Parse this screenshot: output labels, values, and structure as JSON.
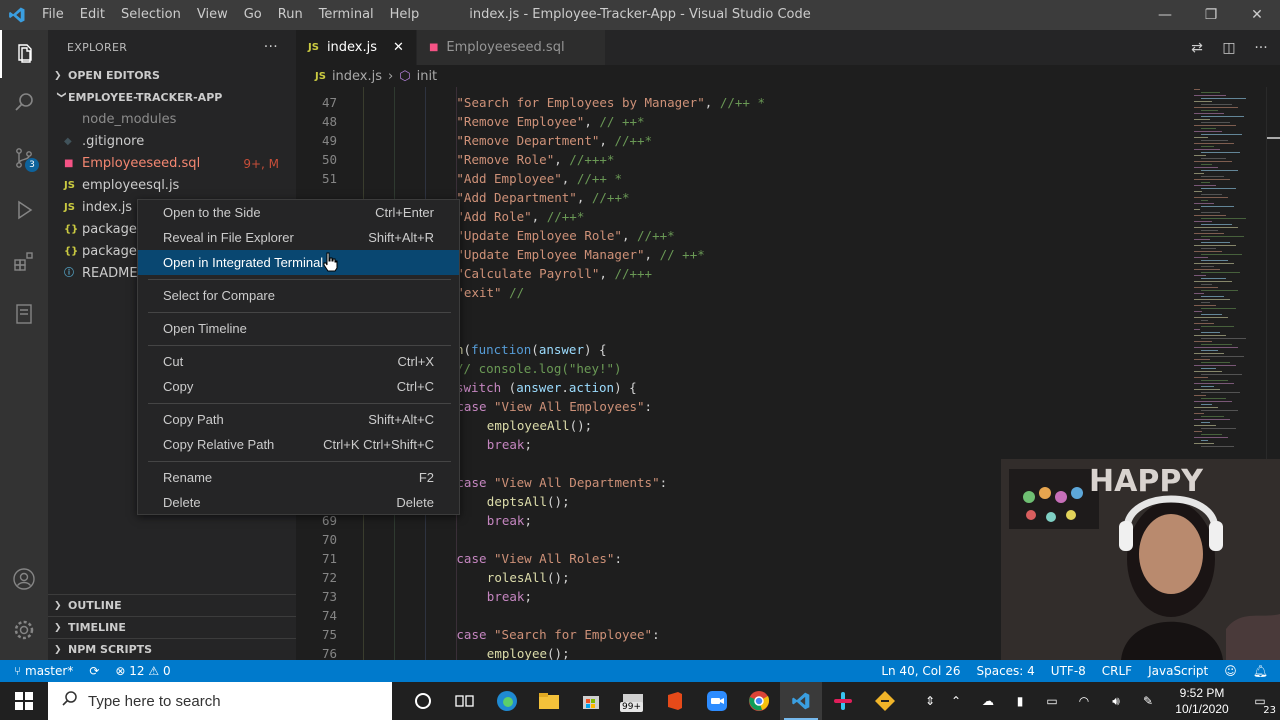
{
  "titlebar": {
    "menus": [
      "File",
      "Edit",
      "Selection",
      "View",
      "Go",
      "Run",
      "Terminal",
      "Help"
    ],
    "title": "index.js - Employee-Tracker-App - Visual Studio Code"
  },
  "activitybar": {
    "badge": "3"
  },
  "sidebar": {
    "title": "EXPLORER",
    "more": "···",
    "open_editors": "OPEN EDITORS",
    "project": "EMPLOYEE-TRACKER-APP",
    "files": [
      {
        "name": "node_modules",
        "icon": "",
        "color": "#8c8c8c",
        "status": ""
      },
      {
        "name": ".gitignore",
        "icon": "◆",
        "iconColor": "#41535b",
        "color": "#cccccc",
        "status": ""
      },
      {
        "name": "Employeeseed.sql",
        "icon": "■",
        "iconColor": "#f55385",
        "color": "#f48771",
        "status": "9+, M"
      },
      {
        "name": "employeesql.js",
        "icon": "JS",
        "iconColor": "#cbcb41",
        "color": "#cccccc",
        "status": ""
      },
      {
        "name": "index.js",
        "icon": "JS",
        "iconColor": "#cbcb41",
        "color": "#cccccc",
        "status": ""
      },
      {
        "name": "package-l",
        "icon": "{}",
        "iconColor": "#cbcb41",
        "color": "#cccccc",
        "status": ""
      },
      {
        "name": "package.js",
        "icon": "{}",
        "iconColor": "#cbcb41",
        "color": "#cccccc",
        "status": ""
      },
      {
        "name": "README.m",
        "icon": "ⓘ",
        "iconColor": "#519aba",
        "color": "#cccccc",
        "status": ""
      }
    ],
    "outline": "OUTLINE",
    "timeline": "TIMELINE",
    "npm": "NPM SCRIPTS"
  },
  "tabs": [
    {
      "label": "index.js",
      "icon": "JS",
      "close": "✕"
    },
    {
      "label": "Employeeseed.sql",
      "icon": "■"
    }
  ],
  "breadcrumb": {
    "file": "index.js",
    "separator": "›",
    "symbol": "init"
  },
  "code": [
    {
      "ln": "47",
      "indent": 4,
      "parts": [
        {
          "t": "\"Search for Employees by Manager\"",
          "c": "str"
        },
        {
          "t": ", ",
          "c": "pl"
        },
        {
          "t": "//++ *",
          "c": "cmt"
        }
      ]
    },
    {
      "ln": "48",
      "indent": 4,
      "parts": [
        {
          "t": "\"Remove Employee\"",
          "c": "str"
        },
        {
          "t": ", ",
          "c": "pl"
        },
        {
          "t": "// ++*",
          "c": "cmt"
        }
      ]
    },
    {
      "ln": "49",
      "indent": 4,
      "parts": [
        {
          "t": "\"Remove Department\"",
          "c": "str"
        },
        {
          "t": ", ",
          "c": "pl"
        },
        {
          "t": "//++*",
          "c": "cmt"
        }
      ]
    },
    {
      "ln": "50",
      "indent": 4,
      "parts": [
        {
          "t": "\"Remove Role\"",
          "c": "str"
        },
        {
          "t": ", ",
          "c": "pl"
        },
        {
          "t": "//+++*",
          "c": "cmt"
        }
      ]
    },
    {
      "ln": "51",
      "indent": 4,
      "parts": [
        {
          "t": "\"Add Employee\"",
          "c": "str"
        },
        {
          "t": ", ",
          "c": "pl"
        },
        {
          "t": "//++ *",
          "c": "cmt"
        }
      ]
    },
    {
      "ln": "",
      "indent": 4,
      "parts": [
        {
          "t": "\"Add Department\"",
          "c": "str"
        },
        {
          "t": ", ",
          "c": "pl"
        },
        {
          "t": "//++*",
          "c": "cmt"
        }
      ]
    },
    {
      "ln": "",
      "indent": 4,
      "parts": [
        {
          "t": "\"Add Role\"",
          "c": "str"
        },
        {
          "t": ", ",
          "c": "pl"
        },
        {
          "t": "//++*",
          "c": "cmt"
        }
      ]
    },
    {
      "ln": "",
      "indent": 4,
      "parts": [
        {
          "t": "\"Update Employee Role\"",
          "c": "str"
        },
        {
          "t": ", ",
          "c": "pl"
        },
        {
          "t": "//++*",
          "c": "cmt"
        }
      ]
    },
    {
      "ln": "",
      "indent": 4,
      "parts": [
        {
          "t": "\"Update Employee Manager\"",
          "c": "str"
        },
        {
          "t": ", ",
          "c": "pl"
        },
        {
          "t": "// ++*",
          "c": "cmt"
        }
      ]
    },
    {
      "ln": "",
      "indent": 4,
      "parts": [
        {
          "t": "\"Calculate Payroll\"",
          "c": "str"
        },
        {
          "t": ", ",
          "c": "pl"
        },
        {
          "t": "//+++",
          "c": "cmt"
        }
      ]
    },
    {
      "ln": "",
      "indent": 4,
      "parts": [
        {
          "t": "\"exit\"",
          "c": "str"
        },
        {
          "t": " ",
          "c": "pl"
        },
        {
          "t": "//",
          "c": "cmt"
        }
      ]
    },
    {
      "ln": "",
      "indent": 0,
      "parts": []
    },
    {
      "ln": "",
      "indent": 0,
      "parts": []
    },
    {
      "ln": "",
      "indent": 0,
      "parts": [
        {
          "t": "n",
          "c": "fn"
        },
        {
          "t": "(",
          "c": "pl"
        },
        {
          "t": "function",
          "c": "kw2"
        },
        {
          "t": "(",
          "c": "pl"
        },
        {
          "t": "answer",
          "c": "var"
        },
        {
          "t": ") {",
          "c": "pl"
        }
      ]
    },
    {
      "ln": "",
      "indent": 0,
      "parts": [
        {
          "t": "// console.log(\"hey!\")",
          "c": "cmt"
        }
      ]
    },
    {
      "ln": "",
      "indent": 0,
      "parts": [
        {
          "t": "switch",
          "c": "kw"
        },
        {
          "t": " (",
          "c": "pl"
        },
        {
          "t": "answer",
          "c": "var"
        },
        {
          "t": ".",
          "c": "pl"
        },
        {
          "t": "action",
          "c": "var"
        },
        {
          "t": ") {",
          "c": "pl"
        }
      ]
    },
    {
      "ln": "",
      "indent": 4,
      "parts": [
        {
          "t": "case",
          "c": "kw"
        },
        {
          "t": " ",
          "c": "pl"
        },
        {
          "t": "\"View All Employees\"",
          "c": "str"
        },
        {
          "t": ":",
          "c": "pl"
        }
      ]
    },
    {
      "ln": "",
      "indent": 8,
      "parts": [
        {
          "t": "employeeAll",
          "c": "fn"
        },
        {
          "t": "();",
          "c": "pl"
        }
      ]
    },
    {
      "ln": "",
      "indent": 8,
      "parts": [
        {
          "t": "break",
          "c": "kw"
        },
        {
          "t": ";",
          "c": "pl"
        }
      ]
    },
    {
      "ln": "",
      "indent": 0,
      "parts": []
    },
    {
      "ln": "",
      "indent": 4,
      "parts": [
        {
          "t": "case",
          "c": "kw"
        },
        {
          "t": " ",
          "c": "pl"
        },
        {
          "t": "\"View All Departments\"",
          "c": "str"
        },
        {
          "t": ":",
          "c": "pl"
        }
      ]
    },
    {
      "ln": "",
      "indent": 8,
      "parts": [
        {
          "t": "deptsAll",
          "c": "fn"
        },
        {
          "t": "();",
          "c": "pl"
        }
      ]
    },
    {
      "ln": "69",
      "indent": 8,
      "parts": [
        {
          "t": "break",
          "c": "kw"
        },
        {
          "t": ";",
          "c": "pl"
        }
      ]
    },
    {
      "ln": "70",
      "indent": 0,
      "parts": []
    },
    {
      "ln": "71",
      "indent": 4,
      "parts": [
        {
          "t": "case",
          "c": "kw"
        },
        {
          "t": " ",
          "c": "pl"
        },
        {
          "t": "\"View All Roles\"",
          "c": "str"
        },
        {
          "t": ":",
          "c": "pl"
        }
      ]
    },
    {
      "ln": "72",
      "indent": 8,
      "parts": [
        {
          "t": "rolesAll",
          "c": "fn"
        },
        {
          "t": "();",
          "c": "pl"
        }
      ]
    },
    {
      "ln": "73",
      "indent": 8,
      "parts": [
        {
          "t": "break",
          "c": "kw"
        },
        {
          "t": ";",
          "c": "pl"
        }
      ]
    },
    {
      "ln": "74",
      "indent": 0,
      "parts": []
    },
    {
      "ln": "75",
      "indent": 4,
      "parts": [
        {
          "t": "case",
          "c": "kw"
        },
        {
          "t": " ",
          "c": "pl"
        },
        {
          "t": "\"Search for Employee\"",
          "c": "str"
        },
        {
          "t": ":",
          "c": "pl"
        }
      ]
    },
    {
      "ln": "76",
      "indent": 8,
      "parts": [
        {
          "t": "employee",
          "c": "fn"
        },
        {
          "t": "();",
          "c": "pl"
        }
      ]
    }
  ],
  "context_menu": {
    "items": [
      {
        "label": "Open to the Side",
        "key": "Ctrl+Enter"
      },
      {
        "label": "Reveal in File Explorer",
        "key": "Shift+Alt+R"
      },
      {
        "label": "Open in Integrated Terminal",
        "key": "",
        "selected": true
      },
      {
        "sep": true
      },
      {
        "label": "Select for Compare",
        "key": ""
      },
      {
        "sep": true
      },
      {
        "label": "Open Timeline",
        "key": ""
      },
      {
        "sep": true
      },
      {
        "label": "Cut",
        "key": "Ctrl+X"
      },
      {
        "label": "Copy",
        "key": "Ctrl+C"
      },
      {
        "sep": true
      },
      {
        "label": "Copy Path",
        "key": "Shift+Alt+C"
      },
      {
        "label": "Copy Relative Path",
        "key": "Ctrl+K Ctrl+Shift+C"
      },
      {
        "sep": true
      },
      {
        "label": "Rename",
        "key": "F2"
      },
      {
        "label": "Delete",
        "key": "Delete"
      }
    ]
  },
  "webcam": {
    "sign_text": "HAPPY"
  },
  "statusbar": {
    "branch": "master*",
    "problems": "12",
    "warnings": "0",
    "position": "Ln 40, Col 26",
    "spaces": "Spaces: 4",
    "encoding": "UTF-8",
    "eol": "CRLF",
    "language": "JavaScript"
  },
  "taskbar": {
    "search_placeholder": "Type here to search",
    "store_badge": "99+",
    "time": "9:52 PM",
    "date": "10/1/2020",
    "notif_count": "23"
  }
}
